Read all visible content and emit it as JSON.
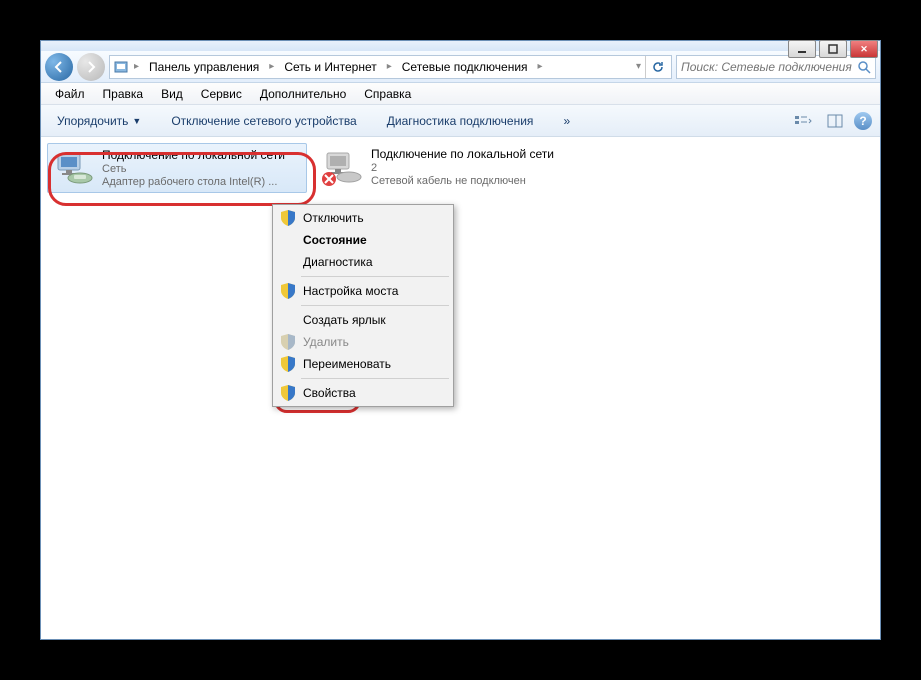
{
  "breadcrumb": {
    "items": [
      "Панель управления",
      "Сеть и Интернет",
      "Сетевые подключения"
    ]
  },
  "search": {
    "placeholder": "Поиск: Сетевые подключения"
  },
  "menubar": {
    "file": "Файл",
    "edit": "Правка",
    "view": "Вид",
    "tools": "Сервис",
    "extra": "Дополнительно",
    "help": "Справка"
  },
  "toolbar": {
    "organize": "Упорядочить",
    "disable": "Отключение сетевого устройства",
    "diagnose": "Диагностика подключения",
    "more": "»"
  },
  "connections": [
    {
      "title": "Подключение по локальной сети",
      "line2": "Сеть",
      "line3": "Адаптер рабочего стола Intel(R) ...",
      "selected": true
    },
    {
      "title": "Подключение по локальной сети",
      "line2": "2",
      "line3": "Сетевой кабель не подключен",
      "selected": false
    }
  ],
  "contextmenu": {
    "disable": "Отключить",
    "status": "Состояние",
    "diagnose": "Диагностика",
    "bridge": "Настройка моста",
    "shortcut": "Создать ярлык",
    "delete": "Удалить",
    "rename": "Переименовать",
    "properties": "Свойства"
  }
}
